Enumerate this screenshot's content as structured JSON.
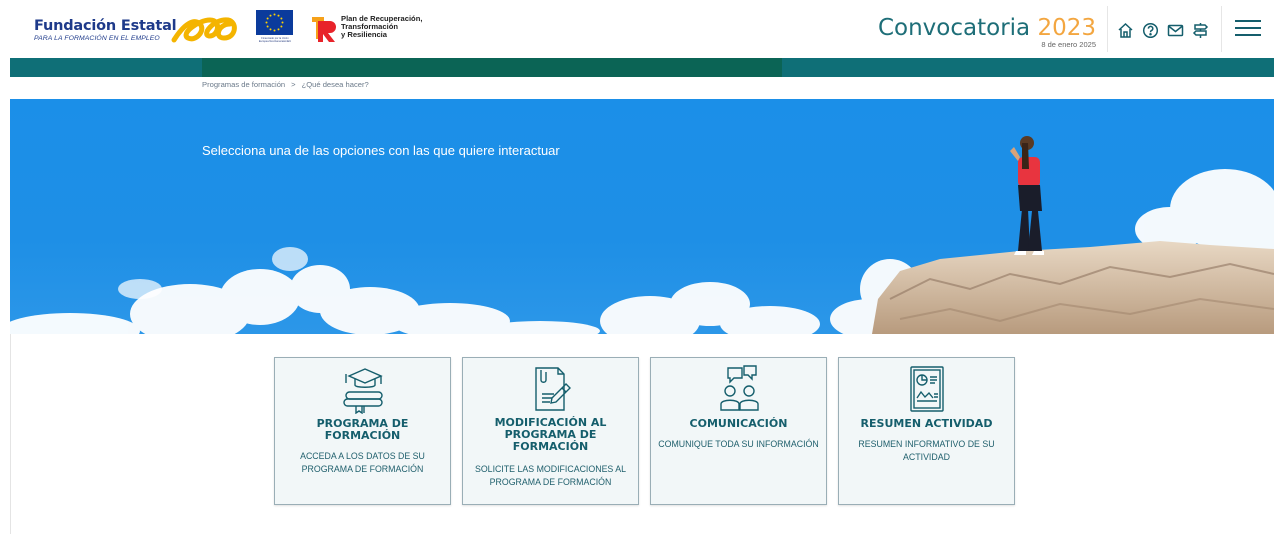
{
  "header": {
    "brand_title": "Fundación Estatal",
    "brand_subtitle": "PARA LA FORMACIÓN EN EL EMPLEO",
    "eu_caption": "Financiado por la Unión Europea NextGenerationEU",
    "plan_line1": "Plan de Recuperación,",
    "plan_line2": "Transformación",
    "plan_line3": "y Resiliencia",
    "convocatoria_label": "Convocatoria",
    "convocatoria_year": "2023",
    "date": "8 de enero 2025",
    "icons": [
      "home-icon",
      "help-icon",
      "mail-icon",
      "signpost-icon"
    ],
    "menu_icon": "hamburger-menu-icon"
  },
  "breadcrumb": {
    "items": [
      "Programas de formación",
      "¿Qué desea hacer?"
    ],
    "separator": ">"
  },
  "hero": {
    "text": "Selecciona una de las opciones con las que quiere interactuar"
  },
  "cards": [
    {
      "icon": "graduation-cap-icon",
      "title": "PROGRAMA DE FORMACIÓN",
      "description": "ACCEDA A LOS DATOS DE SU PROGRAMA DE FORMACIÓN"
    },
    {
      "icon": "document-edit-icon",
      "title": "MODIFICACIÓN AL PROGRAMA DE FORMACIÓN",
      "description": "SOLICITE LAS MODIFICACIONES AL PROGRAMA DE FORMACIÓN"
    },
    {
      "icon": "people-chat-icon",
      "title": "COMUNICACIÓN",
      "description": "COMUNIQUE TODA SU INFORMACIÓN"
    },
    {
      "icon": "report-chart-icon",
      "title": "RESUMEN ACTIVIDAD",
      "description": "RESUMEN INFORMATIVO DE SU ACTIVIDAD"
    }
  ],
  "colors": {
    "teal": "#0f6f77",
    "brand_blue": "#1e3a8a",
    "accent_orange": "#f3a640",
    "sky_blue": "#1e8fe6",
    "card_text": "#155e6c"
  }
}
